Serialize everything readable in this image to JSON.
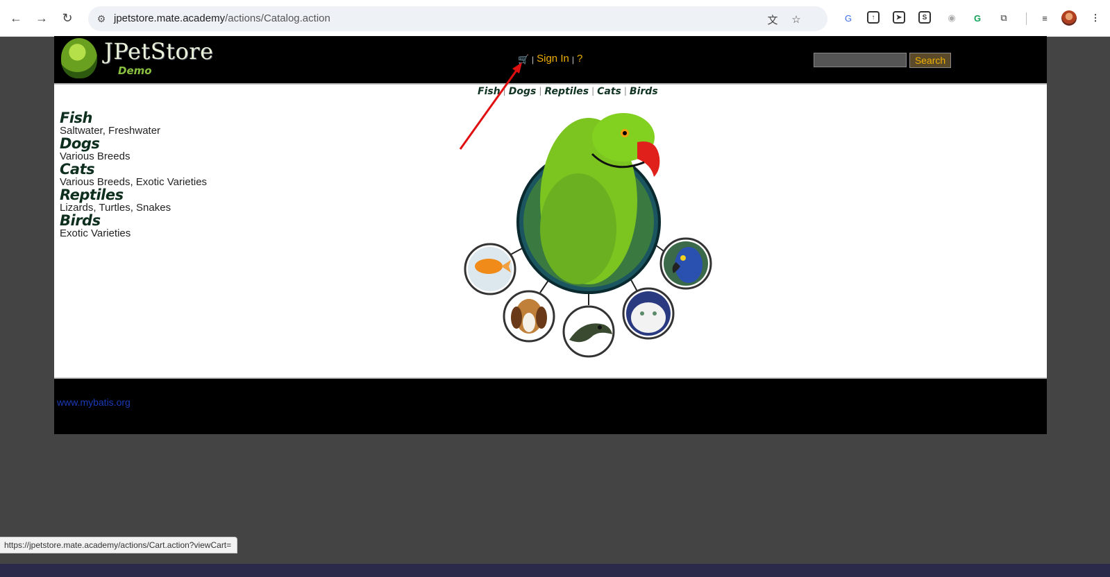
{
  "browser": {
    "url_host": "jpetstore.mate.academy",
    "url_path": "/actions/Catalog.action",
    "status_url": "https://jpetstore.mate.academy/actions/Cart.action?viewCart="
  },
  "header": {
    "logo_name": "JPetStore",
    "logo_sub": "Demo",
    "sign_in": "Sign In",
    "help": "?",
    "search_button": "Search",
    "search_value": ""
  },
  "quicklinks": [
    "Fish",
    "Dogs",
    "Reptiles",
    "Cats",
    "Birds"
  ],
  "categories": [
    {
      "name": "Fish",
      "desc": "Saltwater, Freshwater"
    },
    {
      "name": "Dogs",
      "desc": "Various Breeds"
    },
    {
      "name": "Cats",
      "desc": "Various Breeds, Exotic Varieties"
    },
    {
      "name": "Reptiles",
      "desc": "Lizards, Turtles, Snakes"
    },
    {
      "name": "Birds",
      "desc": "Exotic Varieties"
    }
  ],
  "footer": {
    "link": "www.mybatis.org"
  },
  "colors": {
    "menu_text": "#f0b000",
    "annotation_arrow": "#e01010"
  }
}
